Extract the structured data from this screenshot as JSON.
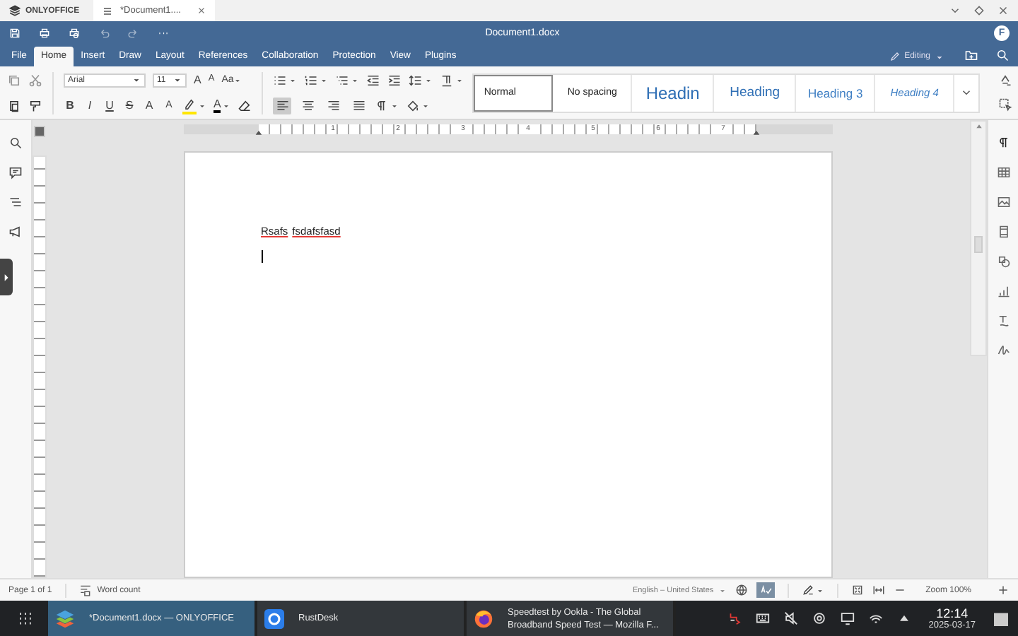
{
  "app_tabs": {
    "logo": "ONLYOFFICE",
    "document_tab": {
      "label": "*Document1....",
      "selected": true
    }
  },
  "title_bar": {
    "title": "Document1.docx",
    "avatar": "F"
  },
  "menu": [
    {
      "label": "File",
      "selected": false
    },
    {
      "label": "Home",
      "selected": true
    },
    {
      "label": "Insert",
      "selected": false
    },
    {
      "label": "Draw",
      "selected": false
    },
    {
      "label": "Layout",
      "selected": false
    },
    {
      "label": "References",
      "selected": false
    },
    {
      "label": "Collaboration",
      "selected": false
    },
    {
      "label": "Protection",
      "selected": false
    },
    {
      "label": "View",
      "selected": false
    },
    {
      "label": "Plugins",
      "selected": false
    }
  ],
  "editing_mode": "Editing",
  "font": {
    "name": "Arial",
    "size": "11"
  },
  "size_buttons": [
    {
      "kind": "grow",
      "label": "A"
    },
    {
      "kind": "shrink",
      "label": "A"
    },
    {
      "kind": "case",
      "label": "Aa"
    }
  ],
  "format_buttons": [
    {
      "kind": "bold",
      "label": "B"
    },
    {
      "kind": "italic",
      "label": "I"
    },
    {
      "kind": "underline",
      "label": "U"
    },
    {
      "kind": "strike",
      "label": "S"
    },
    {
      "kind": "superscript",
      "label": "A"
    },
    {
      "kind": "subscript",
      "label": "A"
    }
  ],
  "font_color_label": "A",
  "alignment": [
    {
      "kind": "left",
      "selected": true
    },
    {
      "kind": "center",
      "selected": false
    },
    {
      "kind": "right",
      "selected": false
    },
    {
      "kind": "justify",
      "selected": false
    }
  ],
  "styles": [
    {
      "label": "Normal",
      "kind": "normal",
      "selected": true
    },
    {
      "label": "No spacing",
      "kind": "plain",
      "selected": false
    },
    {
      "label": "Headin",
      "kind": "heading1",
      "selected": false
    },
    {
      "label": "Heading",
      "kind": "heading2",
      "selected": false
    },
    {
      "label": "Heading 3",
      "kind": "heading3",
      "selected": false
    },
    {
      "label": "Heading 4",
      "kind": "heading4",
      "selected": false
    }
  ],
  "ruler_numbers": [
    "1",
    "2",
    "3",
    "4",
    "5",
    "6",
    "7"
  ],
  "document": {
    "words": [
      {
        "text": "Rsafs",
        "misspelled": true
      },
      {
        "text": "fsdafsfasd",
        "misspelled": true
      }
    ]
  },
  "status_bar": {
    "page": "Page 1 of 1",
    "word_count": "Word count",
    "language": "English – United States",
    "spell_check_on": true,
    "zoom": "Zoom 100%"
  },
  "taskbar": {
    "apps": [
      {
        "kind": "onlyoffice",
        "lines": [
          "*Document1.docx — ONLYOFFICE"
        ],
        "selected": true
      },
      {
        "kind": "rustdesk",
        "lines": [
          "RustDesk"
        ],
        "selected": false
      },
      {
        "kind": "firefox",
        "lines": [
          "Speedtest by Ookla - The Global",
          "Broadband Speed Test — Mozilla F..."
        ],
        "selected": false
      }
    ],
    "time": "12:14",
    "date": "2025-03-17"
  }
}
